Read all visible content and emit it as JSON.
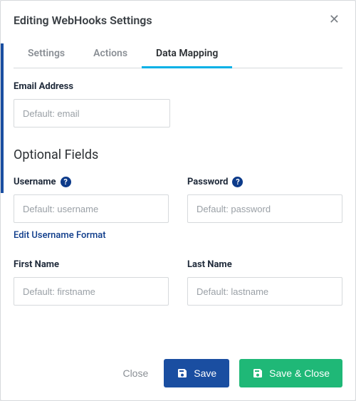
{
  "modal": {
    "title": "Editing WebHooks Settings"
  },
  "tabs": {
    "settings": "Settings",
    "actions": "Actions",
    "data_mapping": "Data Mapping"
  },
  "fields": {
    "email": {
      "label": "Email Address",
      "placeholder": "Default: email",
      "value": ""
    },
    "optional_heading": "Optional Fields",
    "username": {
      "label": "Username",
      "placeholder": "Default: username",
      "value": "",
      "edit_format": "Edit Username Format"
    },
    "password": {
      "label": "Password",
      "placeholder": "Default: password",
      "value": ""
    },
    "first_name": {
      "label": "First Name",
      "placeholder": "Default: firstname",
      "value": ""
    },
    "last_name": {
      "label": "Last Name",
      "placeholder": "Default: lastname",
      "value": ""
    }
  },
  "footer": {
    "close": "Close",
    "save": "Save",
    "save_close": "Save & Close"
  },
  "help_glyph": "?"
}
